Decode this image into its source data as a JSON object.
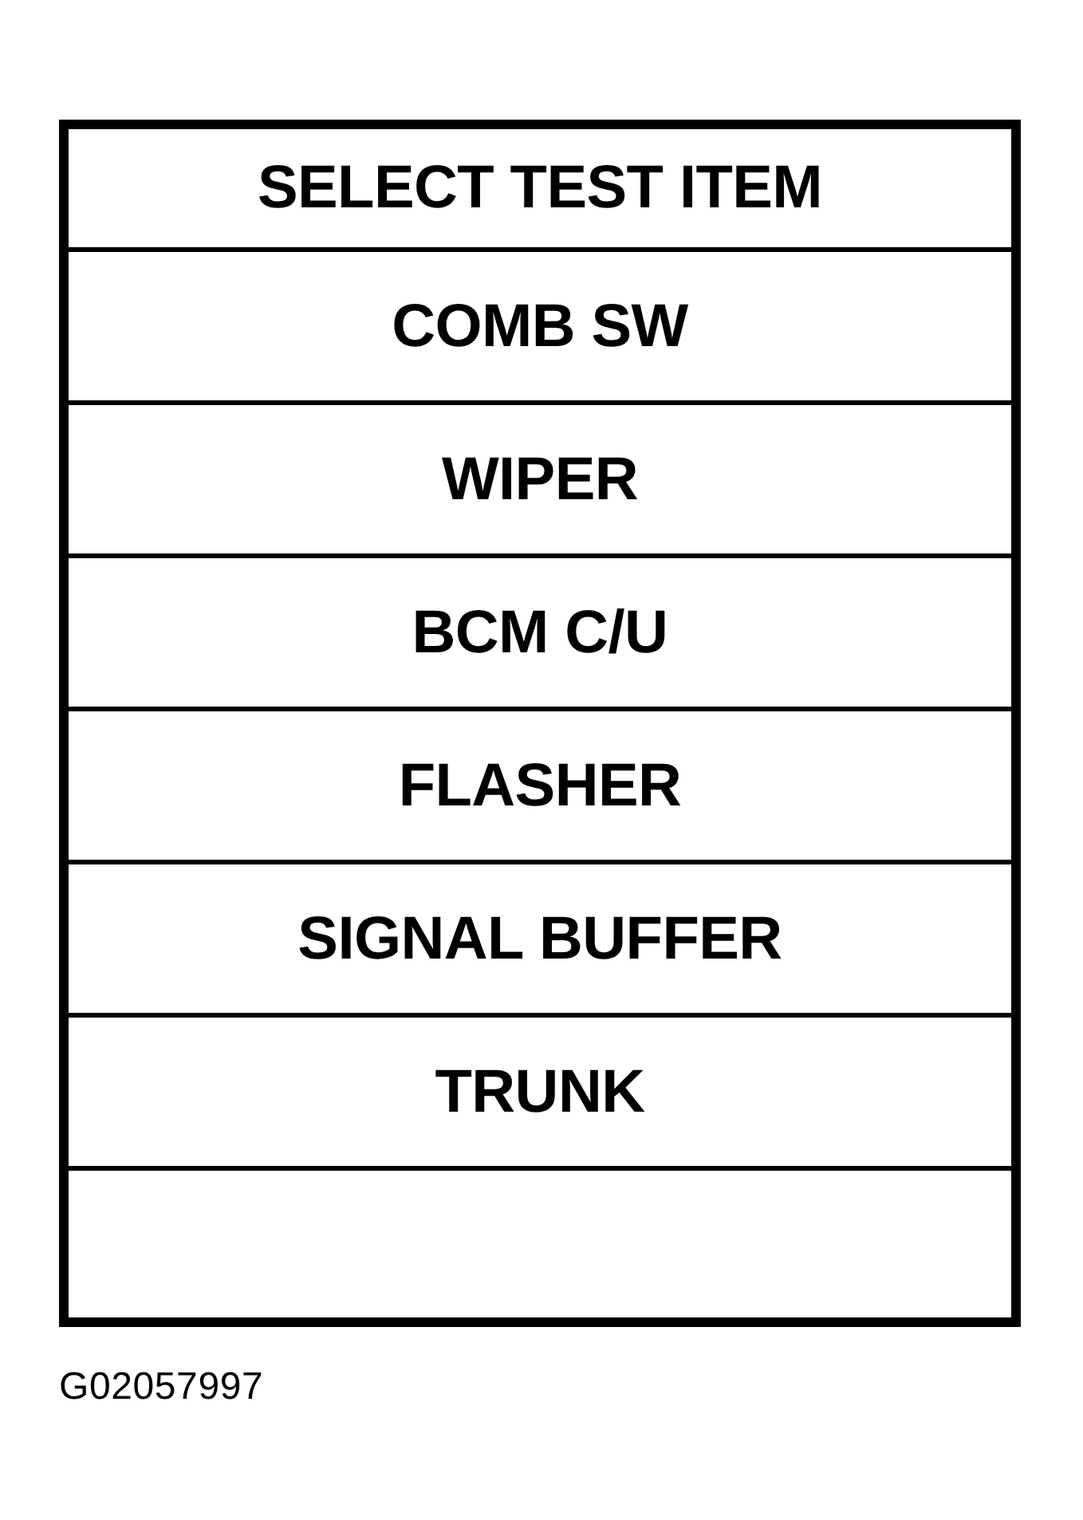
{
  "menu": {
    "title": "SELECT TEST ITEM",
    "items": [
      {
        "label": "COMB SW",
        "selected": false
      },
      {
        "label": "WIPER",
        "selected": false
      },
      {
        "label": "BCM C/U",
        "selected": false
      },
      {
        "label": "FLASHER",
        "selected": false
      },
      {
        "label": "SIGNAL BUFFER",
        "selected": false
      },
      {
        "label": "TRUNK",
        "selected": false
      }
    ]
  },
  "figure_id": "G02057997"
}
